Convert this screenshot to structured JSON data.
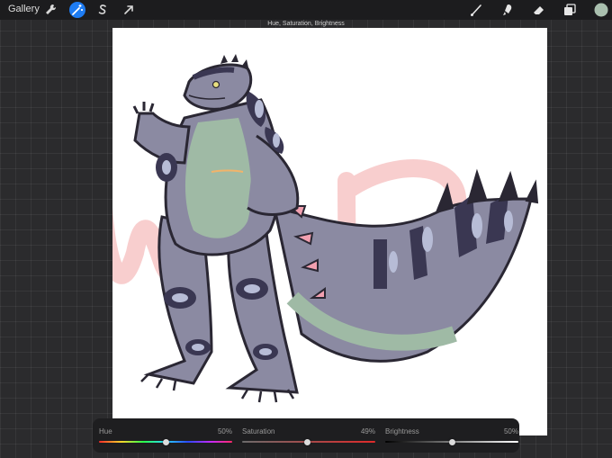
{
  "toolbar": {
    "gallery_label": "Gallery",
    "left_icons": [
      "wrench-icon",
      "magic-wand-icon",
      "selection-s-icon",
      "transform-arrow-icon"
    ],
    "active_icon": "magic-wand-icon",
    "right_icons": [
      "brush-icon",
      "smudge-icon",
      "eraser-icon",
      "layers-icon",
      "color-swatch-icon"
    ],
    "current_color": "#a9bfae",
    "accent_color": "#1e7cf2"
  },
  "mode_label": "Hue, Saturation, Brightness",
  "adjustments": {
    "hue": {
      "label": "Hue",
      "value_text": "50%",
      "value": 0.5
    },
    "saturation": {
      "label": "Saturation",
      "value_text": "49%",
      "value": 0.49
    },
    "brightness": {
      "label": "Brightness",
      "value_text": "50%",
      "value": 0.5
    }
  },
  "artwork": {
    "watermark_text": "WIP",
    "colors": {
      "outline": "#2a2733",
      "body": "#8b8aa2",
      "dark_markings": "#3a3752",
      "light_markings": "#b7bcd6",
      "belly": "#9fbaa5",
      "watermark": "#f3a6a6"
    }
  }
}
